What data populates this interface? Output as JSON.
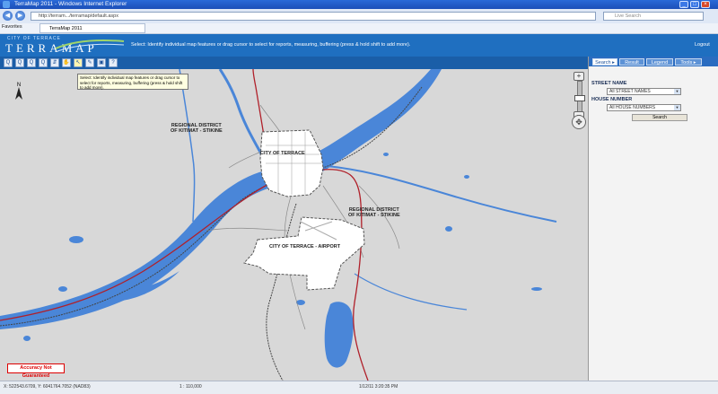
{
  "window": {
    "title": "TerraMap 2011 - Windows Internet Explorer",
    "min": "_",
    "max": "□",
    "close": "×"
  },
  "browser": {
    "back": "◀",
    "forward": "▶",
    "url": "http://terram.../terramap/default.aspx",
    "search_placeholder": "Live Search",
    "favorites_label": "Favorites",
    "tab_title": "TerraMap 2011"
  },
  "app": {
    "logo_small": "CITY OF TERRACE",
    "logo": "TERRAMAP",
    "hint": "Select: Identify individual map features or drag cursor to select for reports, measuring, buffering (press & hold shift to add more).",
    "logout": "Logout",
    "tools": [
      "Q",
      "Q",
      "Q",
      "Q",
      "⇵",
      "✋",
      "↖",
      "✎",
      "▣",
      "?"
    ]
  },
  "tooltip": {
    "text": "Select: Identify individual map features or drag cursor to select for reports, measuring, buffering (press & hold shift to add more)."
  },
  "map": {
    "colors": {
      "land": "#d8d8d8",
      "water": "#4a86d8",
      "road": "#b0202a",
      "minor_road": "#8a8a8a",
      "city": "#ffffff"
    },
    "labels": {
      "rd_west": "REGIONAL DISTRICT\nOF KITIMAT - STIKINE",
      "rd_east": "REGIONAL DISTRICT\nOF KITIMAT - STIKINE",
      "city": "CITY OF TERRACE",
      "airport": "CITY OF TERRACE - AIRPORT"
    },
    "accuracy": "Accuracy Not Guaranteed",
    "north": "N",
    "zoom_in": "+",
    "zoom_out": "−",
    "pan": "✥"
  },
  "panel": {
    "tabs": [
      "Search ▸",
      "Result",
      "Legend",
      "Tools ▸"
    ],
    "street_label": "STREET NAME",
    "street_value": "All STREET NAMES",
    "house_label": "HOUSE NUMBER",
    "house_value": "All HOUSE NUMBERS",
    "search_button": "Search"
  },
  "status": {
    "coords": "X: 522543.6709, Y: 6041764.7052 (NAD83)",
    "scale": "1 : 110,000",
    "date": "1/12/11 3:20:35 PM"
  }
}
